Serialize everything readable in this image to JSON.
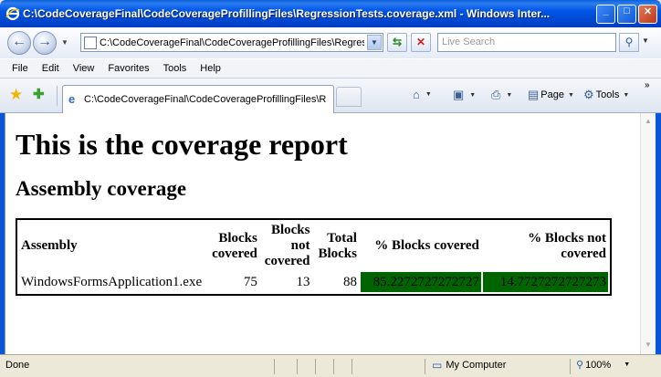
{
  "window": {
    "title": "C:\\CodeCoverageFinal\\CodeCoverageProfillingFiles\\RegressionTests.coverage.xml - Windows Inter...",
    "minimize": "_",
    "maximize": "□",
    "close": "✕"
  },
  "address_bar": {
    "url": "C:\\CodeCoverageFinal\\CodeCoverageProfillingFiles\\Regressi",
    "search_placeholder": "Live Search"
  },
  "menu": [
    "File",
    "Edit",
    "View",
    "Favorites",
    "Tools",
    "Help"
  ],
  "tab": {
    "label": "C:\\CodeCoverageFinal\\CodeCoverageProfillingFiles\\R..."
  },
  "command_bar": {
    "page": "Page",
    "tools": "Tools"
  },
  "page": {
    "heading": "This is the coverage report",
    "subheading": "Assembly coverage",
    "table": {
      "headers": [
        "Assembly",
        "Blocks covered",
        "Blocks not covered",
        "Total Blocks",
        "% Blocks covered",
        "% Blocks not covered"
      ],
      "rows": [
        {
          "assembly": "WindowsFormsApplication1.exe",
          "blocks_covered": "75",
          "blocks_not_covered": "13",
          "total_blocks": "88",
          "pct_covered": "85.2272727272727",
          "pct_not_covered": "14.7727272727273"
        }
      ]
    }
  },
  "status_bar": {
    "text": "Done",
    "zone": "My Computer",
    "zoom": "100%"
  },
  "colors": {
    "title_bar": "#0055e5",
    "coverage_bar": "#006400"
  }
}
